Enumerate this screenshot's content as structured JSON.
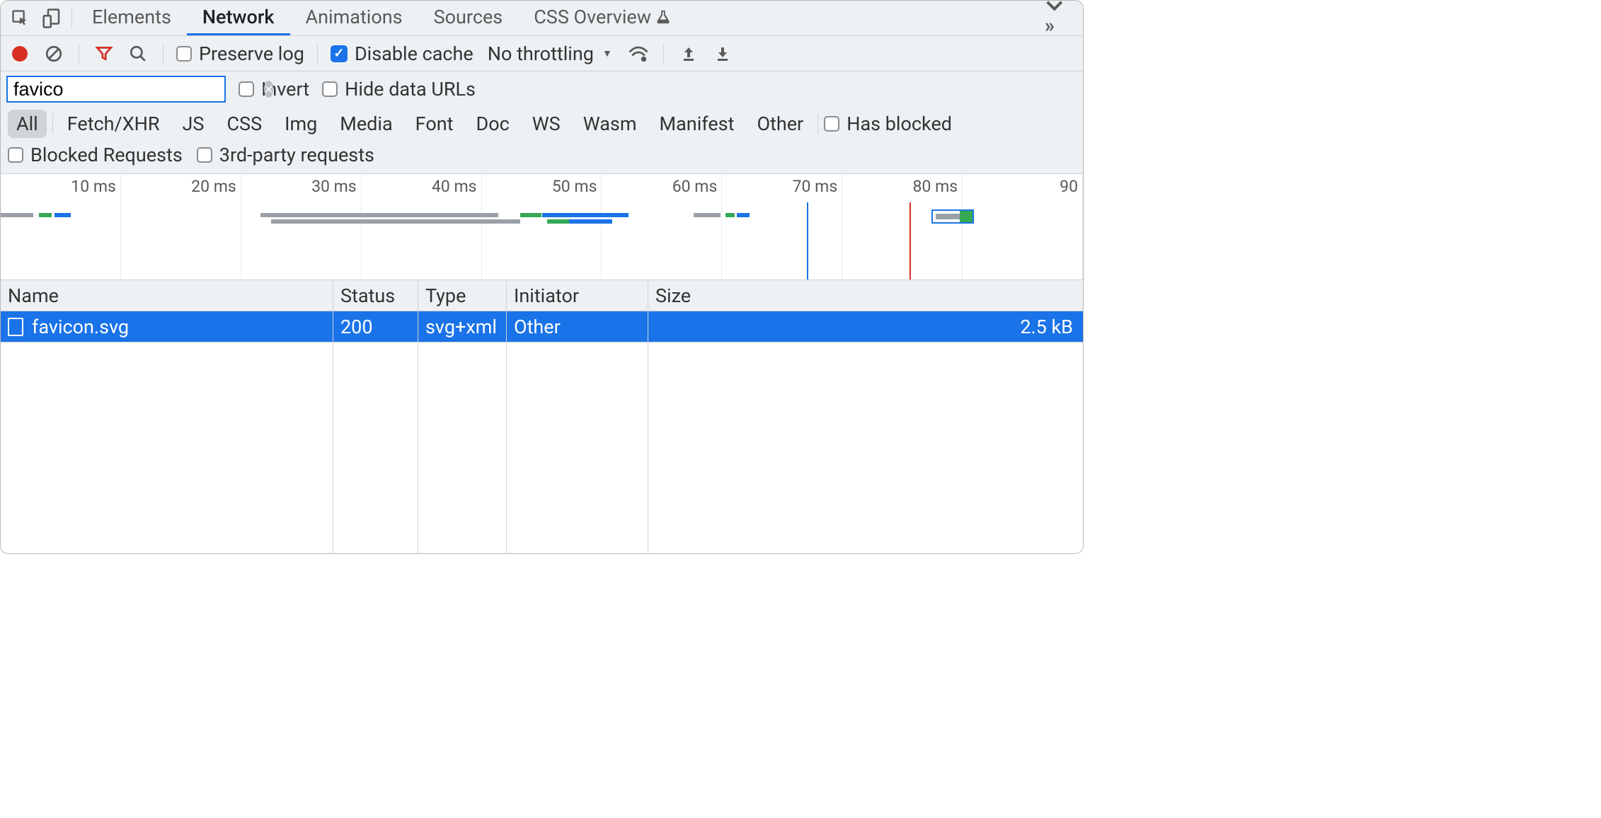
{
  "tabs": {
    "elements": "Elements",
    "network": "Network",
    "animations": "Animations",
    "sources": "Sources",
    "css_overview": "CSS Overview"
  },
  "toolbar": {
    "preserve_log": "Preserve log",
    "disable_cache": "Disable cache",
    "throttling": "No throttling"
  },
  "filter": {
    "value": "favico",
    "invert": "Invert",
    "hide_data_urls": "Hide data URLs"
  },
  "types": {
    "all": "All",
    "fetch": "Fetch/XHR",
    "js": "JS",
    "css": "CSS",
    "img": "Img",
    "media": "Media",
    "font": "Font",
    "doc": "Doc",
    "ws": "WS",
    "wasm": "Wasm",
    "manifest": "Manifest",
    "other": "Other",
    "has_blocked": "Has blocked",
    "blocked_requests": "Blocked Requests",
    "third_party": "3rd-party requests"
  },
  "timeline": {
    "ticks": [
      "10 ms",
      "20 ms",
      "30 ms",
      "40 ms",
      "50 ms",
      "60 ms",
      "70 ms",
      "80 ms",
      "90 "
    ]
  },
  "table": {
    "headers": {
      "name": "Name",
      "status": "Status",
      "type": "Type",
      "initiator": "Initiator",
      "size": "Size"
    },
    "rows": [
      {
        "name": "favicon.svg",
        "status": "200",
        "type": "svg+xml",
        "initiator": "Other",
        "size": "2.5 kB"
      }
    ]
  }
}
